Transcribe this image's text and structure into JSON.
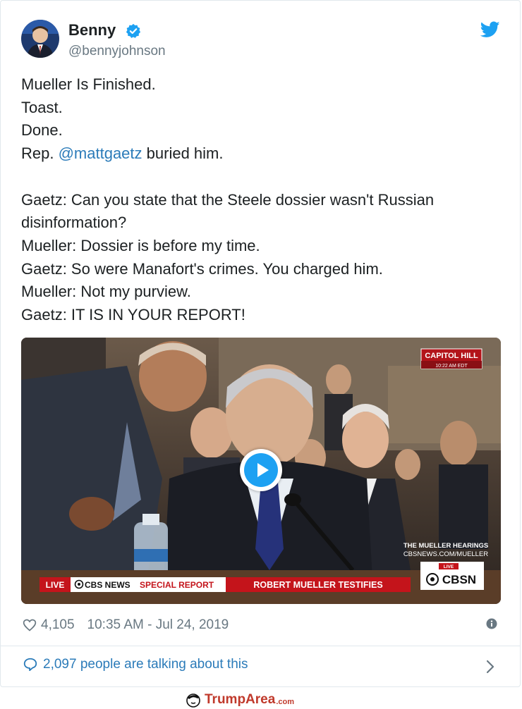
{
  "author": {
    "name": "Benny",
    "handle": "@bennyjohnson",
    "verified": true
  },
  "tweet": {
    "lines": [
      "Mueller Is Finished.",
      "Toast.",
      "Done."
    ],
    "line4_prefix": "Rep. ",
    "line4_mention": "@mattgaetz",
    "line4_suffix": " buried him.",
    "dialogue": [
      "Gaetz: Can you state that the Steele dossier wasn't Russian",
      "disinformation?",
      "Mueller: Dossier is before my time.",
      "Gaetz: So were Manafort's crimes. You charged him.",
      "Mueller: Not my purview.",
      "Gaetz: IT IS IN YOUR REPORT!"
    ]
  },
  "media": {
    "bug_title": "CAPITOL HILL",
    "bug_time": "10:22 AM EDT",
    "hearings_line1": "THE MUELLER HEARINGS",
    "hearings_line2": "CBSNEWS.COM/MUELLER",
    "live_small": "LIVE",
    "network_logo": "CBSN",
    "ticker_live": "LIVE",
    "ticker_network": "CBS NEWS",
    "ticker_special": "SPECIAL REPORT",
    "ticker_headline": "ROBERT MUELLER TESTIFIES"
  },
  "meta": {
    "likes": "4,105",
    "timestamp": "10:35 AM - Jul 24, 2019"
  },
  "conversation": {
    "label": "2,097 people are talking about this"
  },
  "watermark": {
    "brand": "TrumpArea",
    "tld": ".com"
  },
  "colors": {
    "link": "#2b7bb9",
    "twitter_blue": "#1da1f2",
    "muted": "#697882",
    "ticker_red": "#c4141b"
  }
}
